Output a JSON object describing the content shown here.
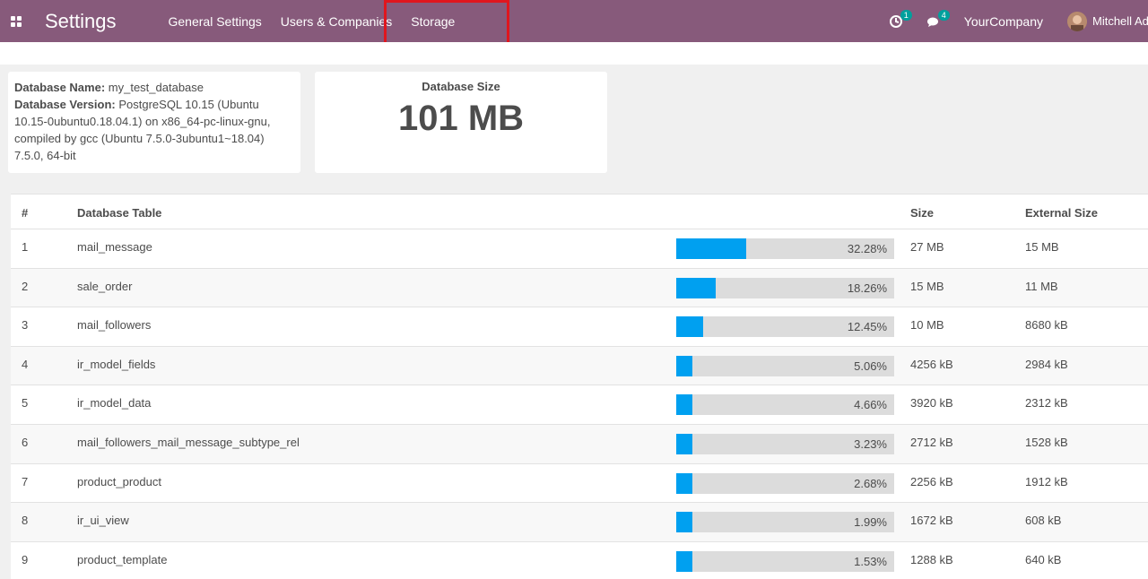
{
  "navbar": {
    "brand": "Settings",
    "menu": [
      "General Settings",
      "Users & Companies",
      "Storage"
    ],
    "activities_badge": "1",
    "messages_badge": "4",
    "company": "YourCompany",
    "user": "Mitchell Admin"
  },
  "db_info": {
    "name_label": "Database Name:",
    "name_value": "my_test_database",
    "version_label": "Database Version:",
    "version_value": "PostgreSQL 10.15 (Ubuntu 10.15-0ubuntu0.18.04.1) on x86_64-pc-linux-gnu, compiled by gcc (Ubuntu 7.5.0-3ubuntu1~18.04) 7.5.0, 64-bit"
  },
  "db_size": {
    "label": "Database Size",
    "value": "101 MB"
  },
  "table": {
    "headers": [
      "#",
      "Database Table",
      "Size",
      "External Size"
    ],
    "rows": [
      {
        "num": "1",
        "name": "mail_message",
        "pct": 32.28,
        "pct_label": "32.28%",
        "size": "27 MB",
        "ext": "15 MB"
      },
      {
        "num": "2",
        "name": "sale_order",
        "pct": 18.26,
        "pct_label": "18.26%",
        "size": "15 MB",
        "ext": "11 MB"
      },
      {
        "num": "3",
        "name": "mail_followers",
        "pct": 12.45,
        "pct_label": "12.45%",
        "size": "10 MB",
        "ext": "8680 kB"
      },
      {
        "num": "4",
        "name": "ir_model_fields",
        "pct": 5.06,
        "pct_label": "5.06%",
        "size": "4256 kB",
        "ext": "2984 kB"
      },
      {
        "num": "5",
        "name": "ir_model_data",
        "pct": 4.66,
        "pct_label": "4.66%",
        "size": "3920 kB",
        "ext": "2312 kB"
      },
      {
        "num": "6",
        "name": "mail_followers_mail_message_subtype_rel",
        "pct": 3.23,
        "pct_label": "3.23%",
        "size": "2712 kB",
        "ext": "1528 kB"
      },
      {
        "num": "7",
        "name": "product_product",
        "pct": 2.68,
        "pct_label": "2.68%",
        "size": "2256 kB",
        "ext": "1912 kB"
      },
      {
        "num": "8",
        "name": "ir_ui_view",
        "pct": 1.99,
        "pct_label": "1.99%",
        "size": "1672 kB",
        "ext": "608 kB"
      },
      {
        "num": "9",
        "name": "product_template",
        "pct": 1.53,
        "pct_label": "1.53%",
        "size": "1288 kB",
        "ext": "640 kB"
      }
    ]
  },
  "colors": {
    "navbar": "#875a7b",
    "bar_fill": "#00a0f0",
    "badge": "#00a09d",
    "highlight": "#e0161e"
  }
}
